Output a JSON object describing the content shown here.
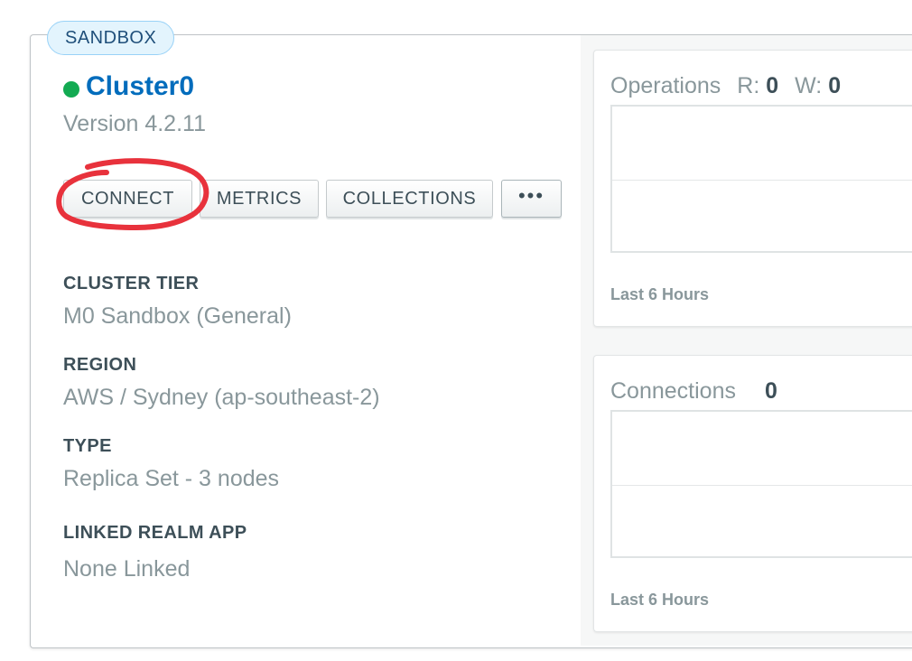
{
  "badge": {
    "label": "SANDBOX"
  },
  "cluster": {
    "name": "Cluster0",
    "version": "Version 4.2.11",
    "status_color": "#13aa52"
  },
  "actions": {
    "connect": "CONNECT",
    "metrics": "METRICS",
    "collections": "COLLECTIONS",
    "more": "•••"
  },
  "annotation": {
    "color": "#e8323c",
    "shape": "hand-drawn circle around CONNECT"
  },
  "details": [
    {
      "label": "CLUSTER TIER",
      "value": "M0 Sandbox (General)"
    },
    {
      "label": "REGION",
      "value": "AWS / Sydney (ap-southeast-2)"
    },
    {
      "label": "TYPE",
      "value": "Replica Set - 3 nodes"
    },
    {
      "label": "LINKED REALM APP",
      "value": "None Linked"
    }
  ],
  "operations": {
    "title": "Operations",
    "read_label": "R:",
    "read_value": "0",
    "write_label": "W:",
    "write_value": "0",
    "footer": "Last 6 Hours"
  },
  "connections": {
    "title": "Connections",
    "value": "0",
    "footer": "Last 6 Hours"
  },
  "colors": {
    "link": "#006cbc",
    "badge_bg": "#e3f4fd",
    "muted_text": "#89979b",
    "label_text": "#3d4f58"
  }
}
